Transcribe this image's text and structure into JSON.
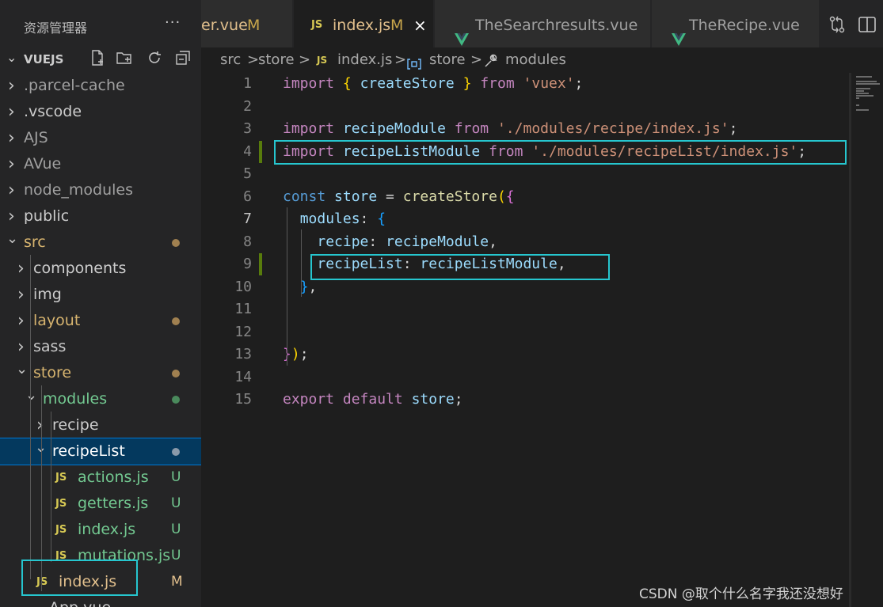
{
  "sidebar": {
    "title": "资源管理器",
    "more": "···",
    "section": "VUEJS",
    "actions": [
      "new-file",
      "new-folder",
      "refresh",
      "collapse-all"
    ],
    "tree": [
      {
        "name": ".parcel-cache",
        "kind": "folder",
        "expanded": false,
        "depth": 0,
        "color": "#a0a0a0"
      },
      {
        "name": ".vscode",
        "kind": "folder",
        "expanded": false,
        "depth": 0,
        "color": "#cccccc"
      },
      {
        "name": "AJS",
        "kind": "folder",
        "expanded": false,
        "depth": 0,
        "color": "#a0a0a0"
      },
      {
        "name": "AVue",
        "kind": "folder",
        "expanded": false,
        "depth": 0,
        "color": "#a0a0a0"
      },
      {
        "name": "node_modules",
        "kind": "folder",
        "expanded": false,
        "depth": 0,
        "color": "#a0a0a0"
      },
      {
        "name": "public",
        "kind": "folder",
        "expanded": false,
        "depth": 0,
        "color": "#cccccc"
      },
      {
        "name": "src",
        "kind": "folder",
        "expanded": true,
        "depth": 0,
        "color": "#d7b46f",
        "dot": "#a08050"
      },
      {
        "name": "components",
        "kind": "folder",
        "expanded": false,
        "depth": 1,
        "color": "#cccccc"
      },
      {
        "name": "img",
        "kind": "folder",
        "expanded": false,
        "depth": 1,
        "color": "#cccccc"
      },
      {
        "name": "layout",
        "kind": "folder",
        "expanded": false,
        "depth": 1,
        "color": "#d7b46f",
        "dot": "#a08050"
      },
      {
        "name": "sass",
        "kind": "folder",
        "expanded": false,
        "depth": 1,
        "color": "#cccccc"
      },
      {
        "name": "store",
        "kind": "folder",
        "expanded": true,
        "depth": 1,
        "color": "#d7b46f",
        "dot": "#a08050"
      },
      {
        "name": "modules",
        "kind": "folder",
        "expanded": true,
        "depth": 2,
        "color": "#73c991",
        "dot": "#4a8a5c"
      },
      {
        "name": "recipe",
        "kind": "folder",
        "expanded": false,
        "depth": 3,
        "color": "#cccccc"
      },
      {
        "name": "recipeList",
        "kind": "folder",
        "expanded": true,
        "depth": 3,
        "color": "#ffffff",
        "dot": "#8a9aaa",
        "selected": true
      },
      {
        "name": "actions.js",
        "kind": "file",
        "depth": 4,
        "color": "#73c991",
        "badge": "U"
      },
      {
        "name": "getters.js",
        "kind": "file",
        "depth": 4,
        "color": "#73c991",
        "badge": "U"
      },
      {
        "name": "index.js",
        "kind": "file",
        "depth": 4,
        "color": "#73c991",
        "badge": "U"
      },
      {
        "name": "mutations.js",
        "kind": "file",
        "depth": 4,
        "color": "#73c991",
        "badge": "U"
      },
      {
        "name": "index.js",
        "kind": "file",
        "depth": 2,
        "color": "#e2c08d",
        "badge": "M"
      },
      {
        "name": "App.vue",
        "kind": "vuefile",
        "depth": 1,
        "color": "#cccccc"
      }
    ],
    "js_icon_label": "JS"
  },
  "tabs": [
    {
      "label": "er.vue",
      "mod": "M",
      "active": false,
      "icon": "none"
    },
    {
      "label": "index.js",
      "mod": "M",
      "active": true,
      "icon": "js",
      "close": "×"
    },
    {
      "label": "TheSearchresults.vue",
      "active": false,
      "icon": "vue"
    },
    {
      "label": "TheRecipe.vue",
      "active": false,
      "icon": "vue"
    }
  ],
  "tab_actions": [
    "compare-changes",
    "split-editor"
  ],
  "breadcrumb": {
    "items": [
      "src",
      "store",
      "index.js",
      "store",
      "modules"
    ],
    "sep": ">"
  },
  "code": {
    "lines": [
      {
        "n": "1",
        "tokens": [
          [
            "kw",
            "import"
          ],
          [
            "pl",
            " "
          ],
          [
            "br1",
            "{"
          ],
          [
            "pl",
            " "
          ],
          [
            "var",
            "createStore"
          ],
          [
            "pl",
            " "
          ],
          [
            "br1",
            "}"
          ],
          [
            "pl",
            " "
          ],
          [
            "kw",
            "from"
          ],
          [
            "pl",
            " "
          ],
          [
            "str",
            "'vuex'"
          ],
          [
            "pl",
            ";"
          ]
        ]
      },
      {
        "n": "2",
        "tokens": []
      },
      {
        "n": "3",
        "tokens": [
          [
            "kw",
            "import"
          ],
          [
            "pl",
            " "
          ],
          [
            "var",
            "recipeModule"
          ],
          [
            "pl",
            " "
          ],
          [
            "kw",
            "from"
          ],
          [
            "pl",
            " "
          ],
          [
            "str",
            "'./modules/recipe/index.js'"
          ],
          [
            "pl",
            ";"
          ]
        ]
      },
      {
        "n": "4",
        "tokens": [
          [
            "kw",
            "import"
          ],
          [
            "pl",
            " "
          ],
          [
            "var",
            "recipeListModule"
          ],
          [
            "pl",
            " "
          ],
          [
            "kw",
            "from"
          ],
          [
            "pl",
            " "
          ],
          [
            "str",
            "'./modules/recipeList/index.js'"
          ],
          [
            "pl",
            ";"
          ]
        ],
        "changed": true
      },
      {
        "n": "5",
        "tokens": []
      },
      {
        "n": "6",
        "tokens": [
          [
            "kw2",
            "const"
          ],
          [
            "pl",
            " "
          ],
          [
            "var",
            "store"
          ],
          [
            "pl",
            " = "
          ],
          [
            "fn",
            "createStore"
          ],
          [
            "br1",
            "("
          ],
          [
            "br2",
            "{"
          ]
        ]
      },
      {
        "n": "7",
        "tokens": [
          [
            "pl",
            "  "
          ],
          [
            "var",
            "modules"
          ],
          [
            "pl",
            ": "
          ],
          [
            "br3",
            "{"
          ]
        ],
        "current": true
      },
      {
        "n": "8",
        "tokens": [
          [
            "pl",
            "    "
          ],
          [
            "var",
            "recipe"
          ],
          [
            "pl",
            ": "
          ],
          [
            "var",
            "recipeModule"
          ],
          [
            "pl",
            ","
          ]
        ]
      },
      {
        "n": "9",
        "tokens": [
          [
            "pl",
            "    "
          ],
          [
            "var",
            "recipeList"
          ],
          [
            "pl",
            ": "
          ],
          [
            "var",
            "recipeListModule"
          ],
          [
            "pl",
            ","
          ]
        ],
        "changed": true
      },
      {
        "n": "10",
        "tokens": [
          [
            "pl",
            "  "
          ],
          [
            "br3",
            "}"
          ],
          [
            "pl",
            ","
          ]
        ]
      },
      {
        "n": "11",
        "tokens": []
      },
      {
        "n": "12",
        "tokens": []
      },
      {
        "n": "13",
        "tokens": [
          [
            "br2",
            "}"
          ],
          [
            "br1",
            ")"
          ],
          [
            "pl",
            ";"
          ]
        ]
      },
      {
        "n": "14",
        "tokens": []
      },
      {
        "n": "15",
        "tokens": [
          [
            "kw",
            "export"
          ],
          [
            "pl",
            " "
          ],
          [
            "kw",
            "default"
          ],
          [
            "pl",
            " "
          ],
          [
            "var",
            "store"
          ],
          [
            "pl",
            ";"
          ]
        ]
      }
    ]
  },
  "watermark": "CSDN @取个什么名字我还没想好",
  "colors": {
    "highlight_box": "#26c6cf",
    "git_added": "#587c0c",
    "modified": "#e2c08d",
    "untracked": "#73c991"
  }
}
